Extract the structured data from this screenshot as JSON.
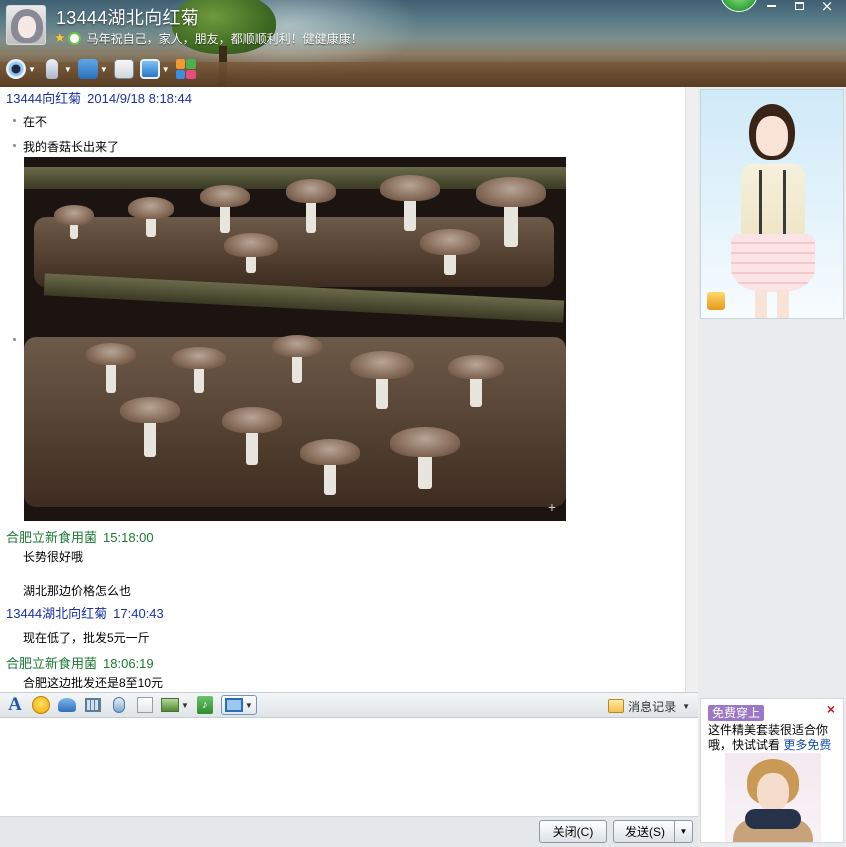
{
  "window": {
    "title": "13444湖北向红菊",
    "signature": "马年祝自己，家人，朋友，都顺顺利利！健健康康！",
    "controls": {
      "min": "—",
      "max": "□",
      "close": "×"
    }
  },
  "top_toolbar": {
    "icons": [
      "video-call-icon",
      "voice-call-icon",
      "file-transfer-icon",
      "doc-share-icon",
      "remote-desktop-icon",
      "apps-icon"
    ]
  },
  "chat": {
    "messages": [
      {
        "sender": "13444向红菊",
        "time": "2014/9/18 8:18:44",
        "lines": [
          "在不",
          "我的香菇长出来了"
        ],
        "has_image": true
      },
      {
        "sender": "合肥立新食用菌",
        "time": "15:18:00",
        "lines": [
          "长势很好哦",
          "湖北那边价格怎么也"
        ]
      },
      {
        "sender": "13444湖北向红菊",
        "time": "17:40:43",
        "lines": [
          "现在低了，批发5元一斤"
        ]
      },
      {
        "sender": "合肥立新食用菌",
        "time": "18:06:19",
        "lines": [
          "合肥这边批发还是8至10元"
        ]
      }
    ],
    "image_plus": "+"
  },
  "input_toolbar": {
    "history_label": "消息记录"
  },
  "buttons": {
    "close_label": "关闭(C)",
    "send_label": "发送(S)"
  },
  "ad": {
    "badge": "免费穿上",
    "text": "这件精美套装很适合你哦，快试试看",
    "more": "更多免费",
    "close": "×"
  },
  "colors": {
    "sender_self": "#1a32a8",
    "sender_other": "#1b7a33",
    "ad_badge": "#9b77c8"
  }
}
